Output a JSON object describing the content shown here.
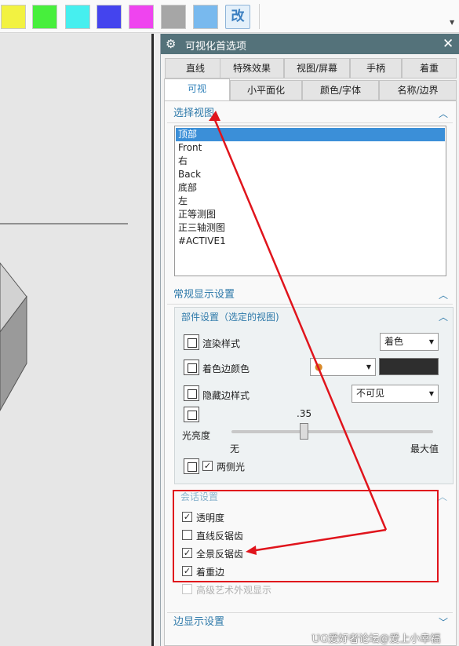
{
  "toolbar": {
    "swatches": [
      {
        "name": "yellow",
        "color": "#f2f241"
      },
      {
        "name": "green",
        "color": "#47ef3c"
      },
      {
        "name": "cyan",
        "color": "#46efef"
      },
      {
        "name": "blue",
        "color": "#4444ee"
      },
      {
        "name": "magenta",
        "color": "#ef44ef"
      },
      {
        "name": "gray",
        "color": "#a6a6a6"
      },
      {
        "name": "light-blue",
        "color": "#78b9ee"
      }
    ],
    "edit_label": "改",
    "dropdown_icon": "chevron-down-icon"
  },
  "dialog": {
    "title": "可视化首选项",
    "title_icon": "gear-icon",
    "close_icon": "close-icon",
    "tabs_row1": [
      "直线",
      "特殊效果",
      "视图/屏幕",
      "手柄",
      "着重"
    ],
    "tabs_row2": [
      "可视",
      "小平面化",
      "颜色/字体",
      "名称/边界"
    ],
    "active_tab": "可视",
    "select_view": {
      "header": "选择视图",
      "items": [
        "顶部",
        "Front",
        "右",
        "Back",
        "底部",
        "左",
        "正等测图",
        "正三轴测图",
        "#ACTIVE1"
      ],
      "selected": "顶部"
    },
    "general": {
      "header": "常规显示设置",
      "part": {
        "header": "部件设置（选定的视图)",
        "render_style_label": "渲染样式",
        "render_style_value": "着色",
        "shaded_edge_color_label": "着色边颜色",
        "hidden_edge_style_label": "隐藏边样式",
        "hidden_edge_style_value": "不可见",
        "brightness_label": "光亮度",
        "brightness_value": ".35",
        "brightness_min": "无",
        "brightness_max": "最大值",
        "two_sided_light_label": "两侧光",
        "two_sided_light_checked": true,
        "shaded_edge_color": "#2e2e2e"
      },
      "session": {
        "header": "会话设置",
        "transparency_label": "透明度",
        "transparency_checked": true,
        "line_aa_label": "直线反锯齿",
        "line_aa_checked": false,
        "fullscene_aa_label": "全景反锯齿",
        "fullscene_aa_checked": true,
        "emphasis_edges_label": "着重边",
        "emphasis_edges_checked": true,
        "advanced_look_label": "高级艺术外观显示",
        "advanced_look_checked": false
      }
    },
    "edge_display": {
      "header": "边显示设置"
    }
  },
  "annotation": {
    "color": "#e0141c"
  },
  "watermark": "UG爱好者论坛@爱上小幸福"
}
